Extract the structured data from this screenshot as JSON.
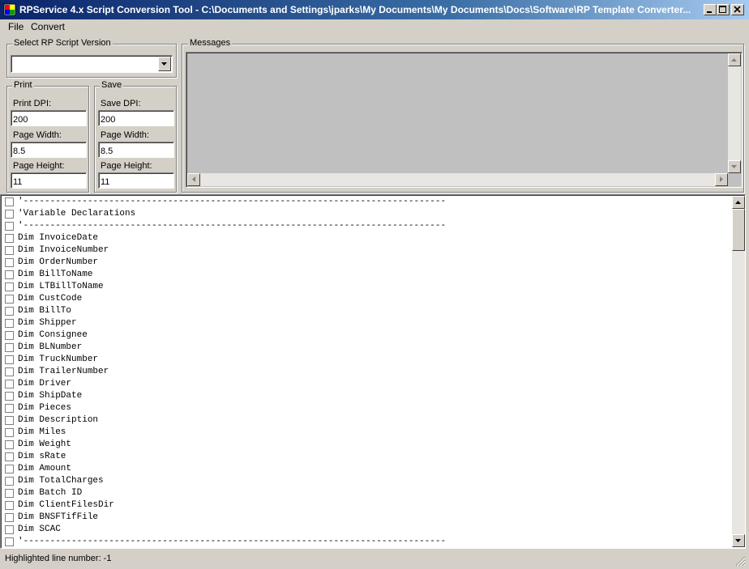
{
  "window": {
    "title": "RPService 4.x Script Conversion Tool - C:\\Documents and Settings\\jparks\\My Documents\\My Documents\\Docs\\Software\\RP Template Converter..."
  },
  "menu": {
    "items": [
      "File",
      "Convert"
    ]
  },
  "script_version": {
    "label": "Select RP Script Version",
    "value": ""
  },
  "print": {
    "label": "Print",
    "dpi_label": "Print DPI:",
    "dpi_value": "200",
    "width_label": "Page Width:",
    "width_value": "8.5",
    "height_label": "Page Height:",
    "height_value": "11"
  },
  "save": {
    "label": "Save",
    "dpi_label": "Save DPI:",
    "dpi_value": "200",
    "width_label": "Page Width:",
    "width_value": "8.5",
    "height_label": "Page Height:",
    "height_value": "11"
  },
  "messages": {
    "label": "Messages"
  },
  "code_lines": [
    "'-------------------------------------------------------------------------------",
    "'Variable Declarations",
    "'-------------------------------------------------------------------------------",
    "Dim InvoiceDate",
    "Dim InvoiceNumber",
    "Dim OrderNumber",
    "Dim BillToName",
    "Dim LTBillToName",
    "Dim CustCode",
    "Dim BillTo",
    "Dim Shipper",
    "Dim Consignee",
    "Dim BLNumber",
    "Dim TruckNumber",
    "Dim TrailerNumber",
    "Dim Driver",
    "Dim ShipDate",
    "Dim Pieces",
    "Dim Description",
    "Dim Miles",
    "Dim Weight",
    "Dim sRate",
    "Dim Amount",
    "Dim TotalCharges",
    "Dim Batch ID",
    "Dim ClientFilesDir",
    "Dim BNSFTifFile",
    "Dim SCAC",
    "'-------------------------------------------------------------------------------"
  ],
  "status": {
    "text": "Highlighted line number: -1"
  },
  "icons": {
    "app": "app-icon",
    "minimize": "minimize-icon",
    "maximize": "maximize-icon",
    "close": "close-icon",
    "dropdown": "chevron-down-icon",
    "scroll_up": "arrow-up-icon",
    "scroll_down": "arrow-down-icon",
    "scroll_left": "arrow-left-icon",
    "scroll_right": "arrow-right-icon",
    "grip": "size-grip-icon"
  },
  "colors": {
    "titlebar_start": "#0a246a",
    "titlebar_end": "#a6caf0",
    "face": "#d4d0c8",
    "messages_bg": "#c0c0c0"
  }
}
